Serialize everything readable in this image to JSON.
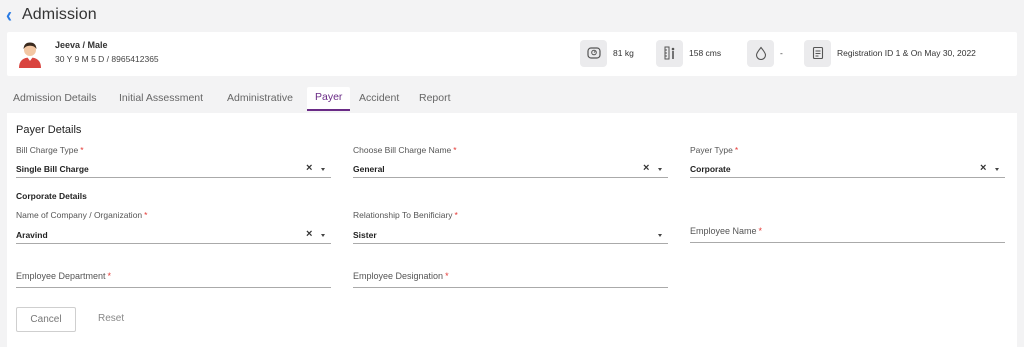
{
  "header": {
    "title": "Admission"
  },
  "patient": {
    "name": "Jeeva / Male",
    "info": "30 Y 9 M 5 D / 8965412365",
    "vitals": {
      "weight": "81 kg",
      "height": "158 cms",
      "blood_group": "-",
      "registration": "Registration ID 1 & On May 30, 2022"
    }
  },
  "tabs": [
    "Admission Details",
    "Initial Assessment",
    "Administrative",
    "Payer",
    "Accident",
    "Report"
  ],
  "form": {
    "section_title": "Payer Details",
    "corporate_title": "Corporate Details",
    "required_mark": "*",
    "bill_charge_type": {
      "label": "Bill Charge Type",
      "value": "Single Bill Charge"
    },
    "bill_charge_name": {
      "label": "Choose Bill Charge Name",
      "value": "General"
    },
    "payer_type": {
      "label": "Payer Type",
      "value": "Corporate"
    },
    "company": {
      "label": "Name of Company / Organization",
      "value": "Aravind"
    },
    "relationship": {
      "label": "Relationship To Benificiary",
      "value": "Sister"
    },
    "employee_name": {
      "label": "Employee Name"
    },
    "employee_department": {
      "label": "Employee Department"
    },
    "employee_designation": {
      "label": "Employee Designation"
    },
    "clear_symbol": "×"
  },
  "buttons": {
    "cancel": "Cancel",
    "reset": "Reset"
  },
  "colors": {
    "accent": "#6a2b86",
    "back_arrow": "#2a7be4",
    "required": "#e53935"
  }
}
